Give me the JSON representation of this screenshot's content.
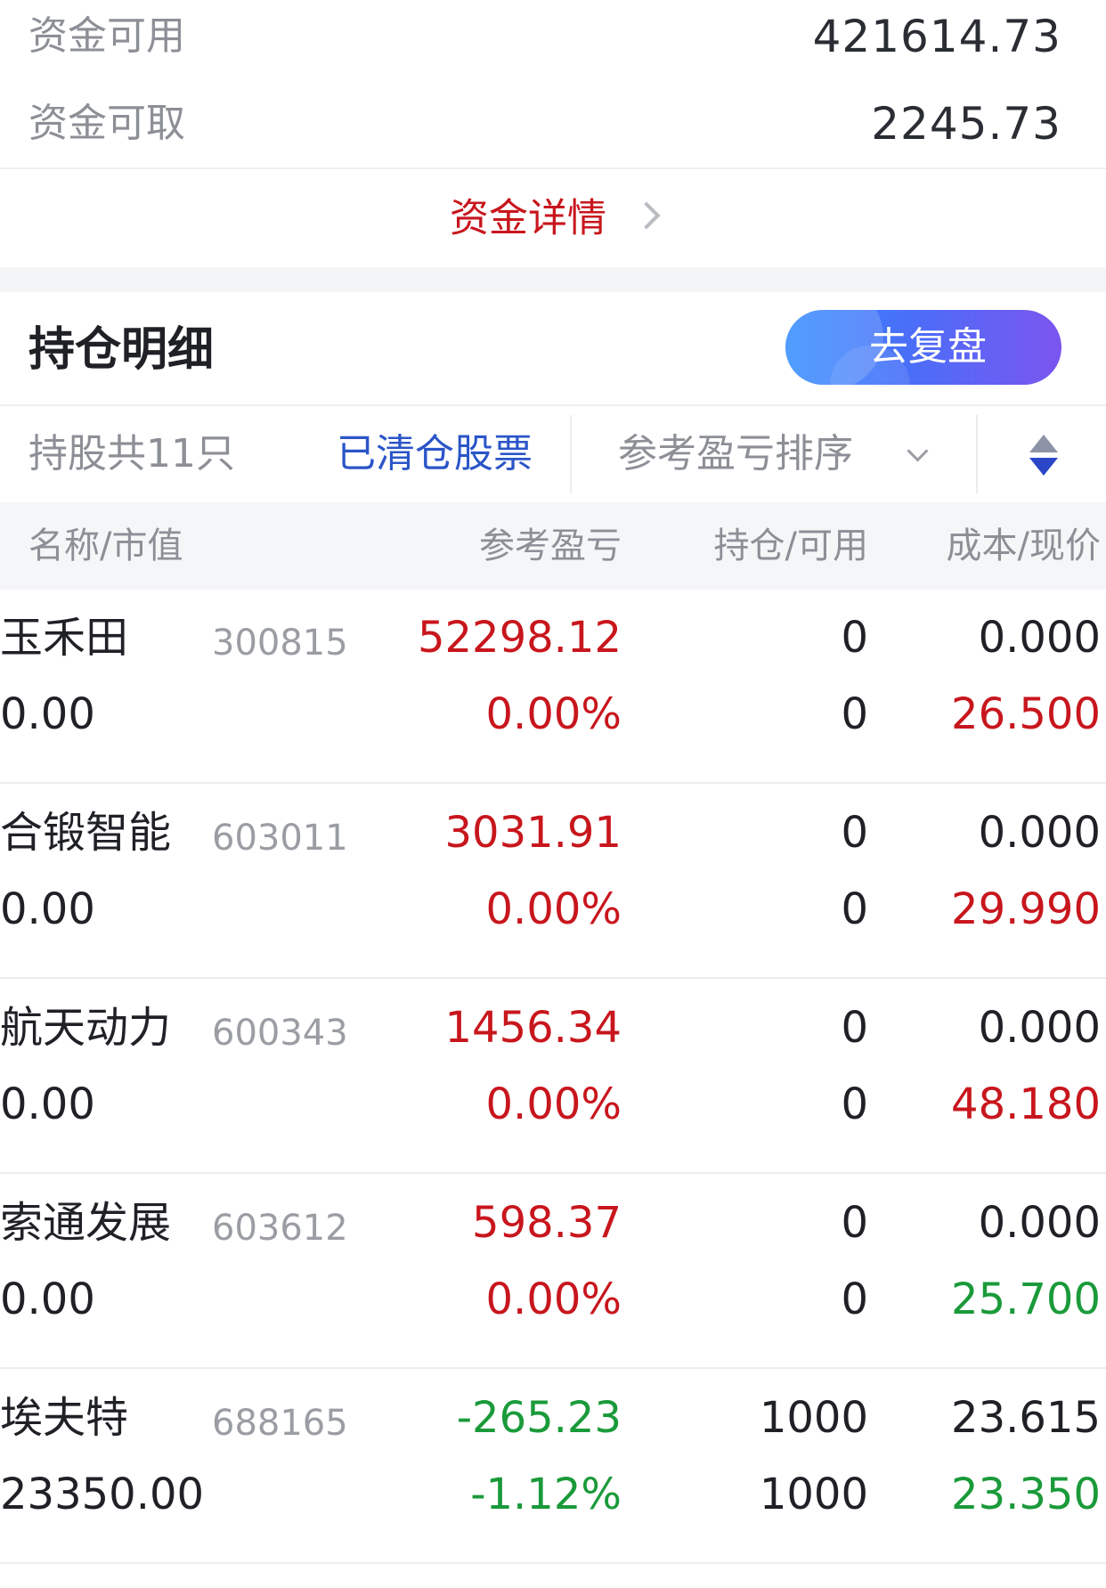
{
  "funds": {
    "available_label": "资金可用",
    "available_value": "421614.73",
    "withdrawable_label": "资金可取",
    "withdrawable_value": "2245.73",
    "detail_link": "资金详情"
  },
  "holdings": {
    "title": "持仓明细",
    "replay_button": "去复盘",
    "count_label": "持股共11只",
    "cleared_link": "已清仓股票",
    "sort_label": "参考盈亏排序",
    "columns": [
      "名称/市值",
      "参考盈亏",
      "持仓/可用",
      "成本/现价"
    ],
    "rows": [
      {
        "name": "玉禾田",
        "code": "300815",
        "market_value": "0.00",
        "pnl": "52298.12",
        "pnl_pct": "0.00%",
        "holding": "0",
        "available": "0",
        "cost": "0.000",
        "price": "26.500"
      },
      {
        "name": "合锻智能",
        "code": "603011",
        "market_value": "0.00",
        "pnl": "3031.91",
        "pnl_pct": "0.00%",
        "holding": "0",
        "available": "0",
        "cost": "0.000",
        "price": "29.990"
      },
      {
        "name": "航天动力",
        "code": "600343",
        "market_value": "0.00",
        "pnl": "1456.34",
        "pnl_pct": "0.00%",
        "holding": "0",
        "available": "0",
        "cost": "0.000",
        "price": "48.180"
      },
      {
        "name": "索通发展",
        "code": "603612",
        "market_value": "0.00",
        "pnl": "598.37",
        "pnl_pct": "0.00%",
        "holding": "0",
        "available": "0",
        "cost": "0.000",
        "price": "25.700"
      },
      {
        "name": "埃夫特",
        "code": "688165",
        "market_value": "23350.00",
        "pnl": "-265.23",
        "pnl_pct": "-1.12%",
        "holding": "1000",
        "available": "1000",
        "cost": "23.615",
        "price": "23.350"
      }
    ]
  },
  "colors": {
    "up": "#c8161d",
    "down": "#1a9a3a",
    "link_blue": "#2b55c8",
    "muted": "#8c8f96"
  },
  "icons": [
    "chevron-right-icon",
    "chevron-down-icon",
    "sort-toggle-icon"
  ]
}
